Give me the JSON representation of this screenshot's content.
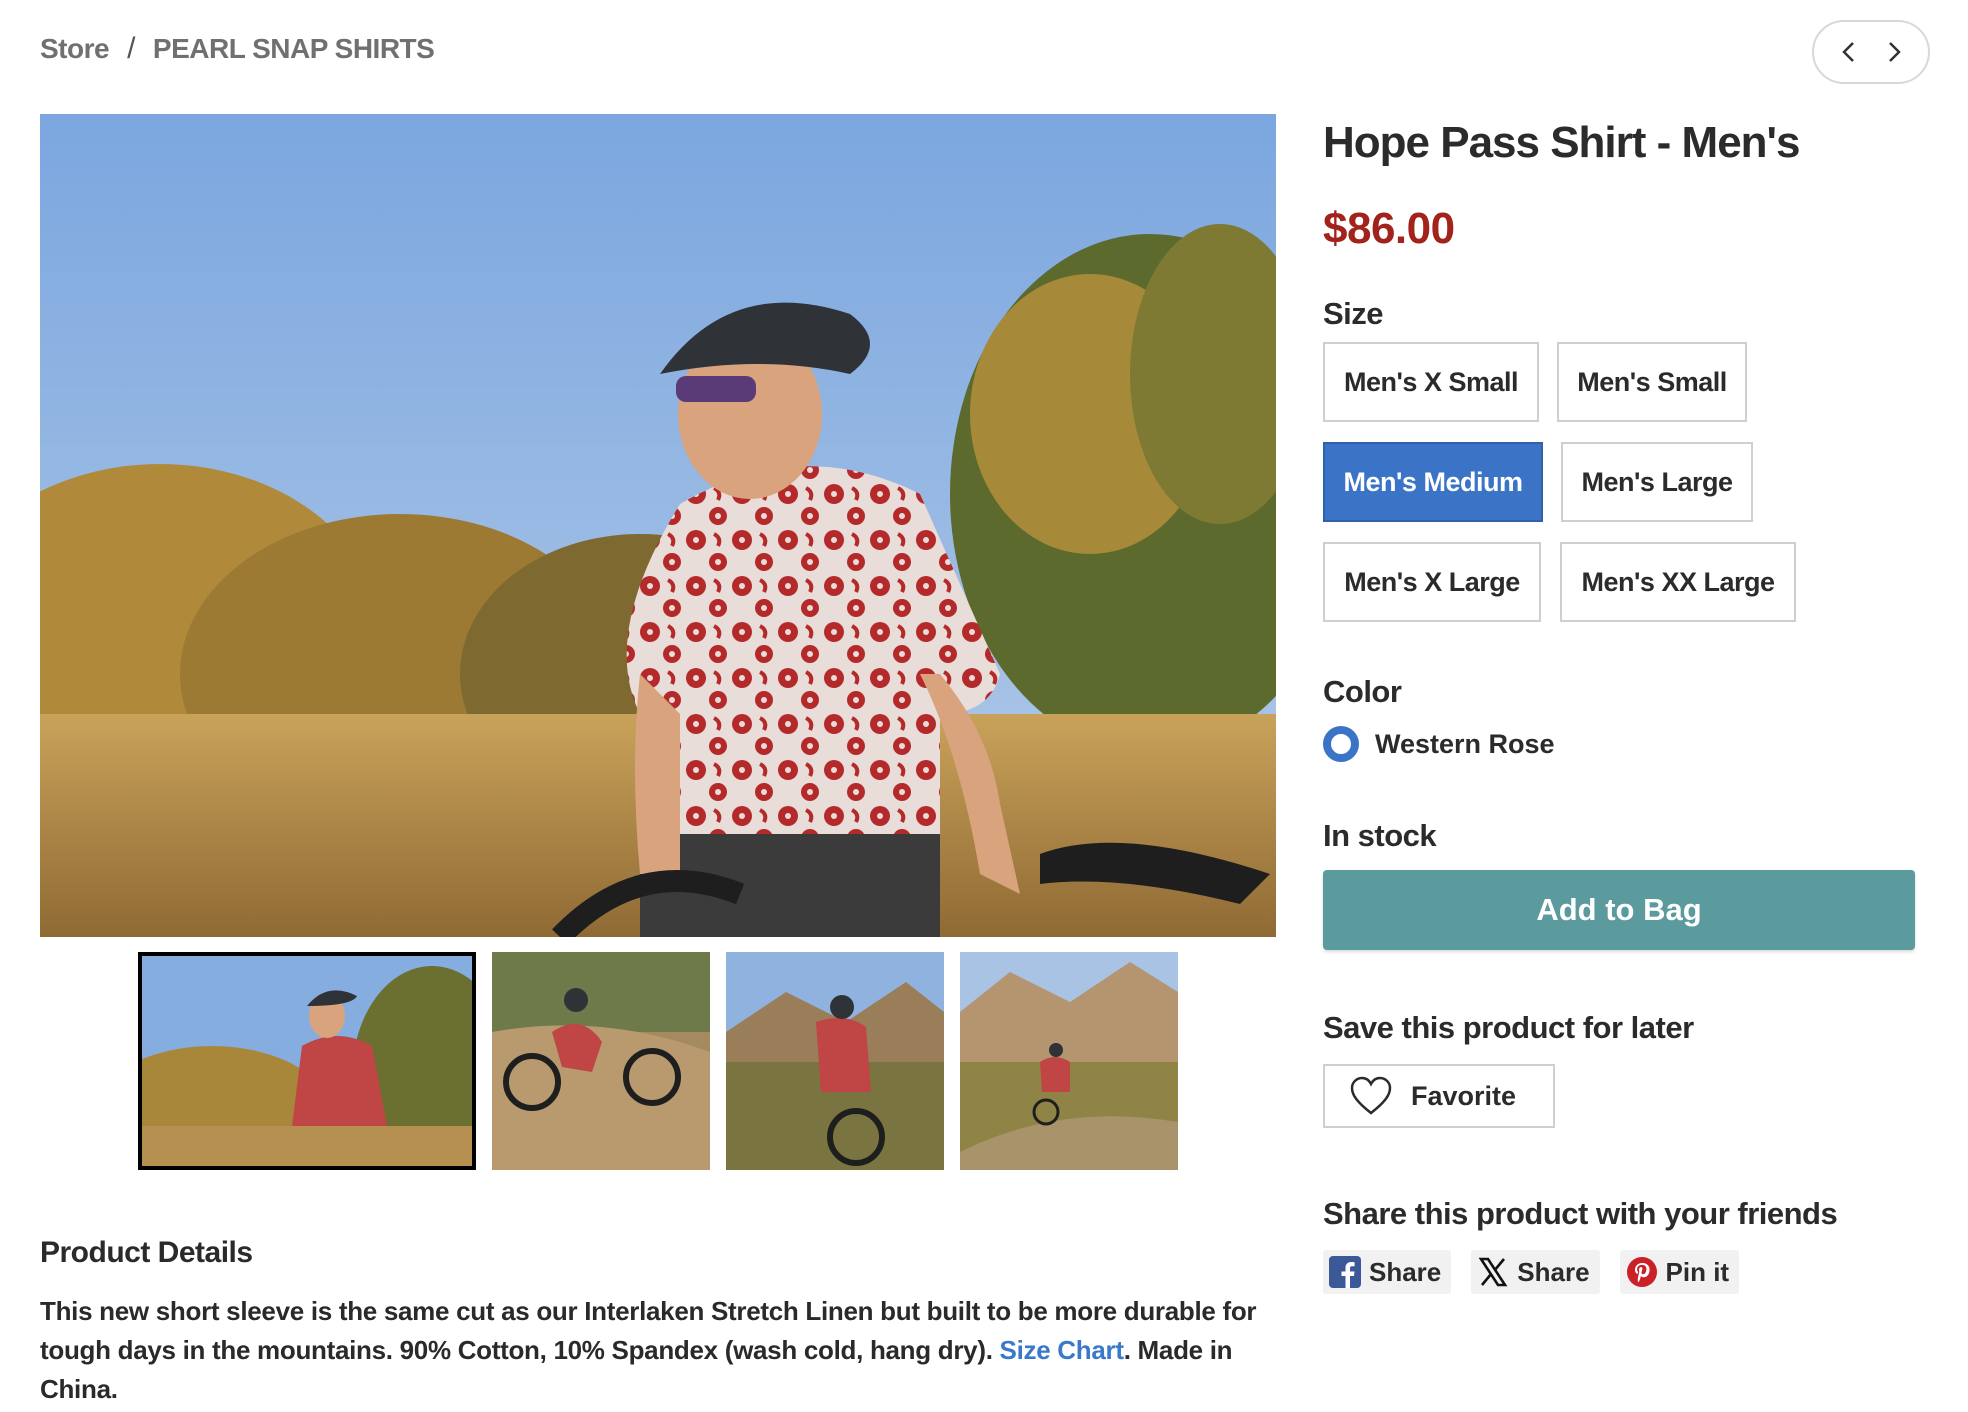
{
  "breadcrumb": {
    "store": "Store",
    "separator": "/",
    "category": "PEARL SNAP SHIRTS"
  },
  "pager": {
    "prev_icon": "chevron-left-icon",
    "next_icon": "chevron-right-icon"
  },
  "product": {
    "title": "Hope Pass Shirt - Men's",
    "price": "$86.00",
    "size_label": "Size",
    "sizes": [
      "Men's X Small",
      "Men's Small",
      "Men's Medium",
      "Men's Large",
      "Men's X Large",
      "Men's XX Large"
    ],
    "selected_size": "Men's Medium",
    "color_label": "Color",
    "color_value": "Western Rose",
    "stock": "In stock",
    "add_to_bag": "Add to Bag",
    "save_label": "Save this product for later",
    "favorite": "Favorite",
    "share_label": "Share this product with your friends",
    "share": {
      "facebook": "Share",
      "x": "Share",
      "pinterest": "Pin it"
    }
  },
  "details": {
    "title": "Product Details",
    "text_before": "This new short sleeve is the same cut as our Interlaken Stretch Linen but built to be more durable for tough days in the mountains. 90% Cotton, 10% Spandex (wash cold, hang dry). ",
    "link": "Size Chart",
    "text_after": ". Made in China."
  },
  "colors": {
    "price": "#a2231c",
    "selected_size": "#3b74c7",
    "add_to_bag": "#5b9b9e",
    "link": "#3a78c9"
  }
}
